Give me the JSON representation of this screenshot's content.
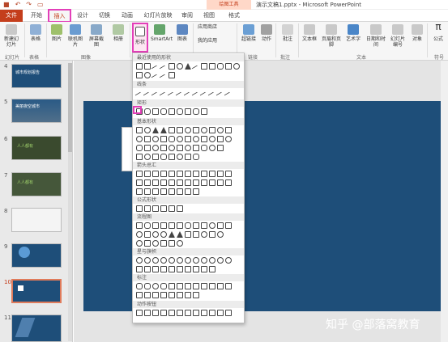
{
  "title_bar": {
    "context_tab": "绘图工具",
    "document_title": "演示文稿1.pptx - Microsoft PowerPoint",
    "qat": [
      "save-icon",
      "undo-icon",
      "redo-icon",
      "present-icon"
    ]
  },
  "tabs": [
    "文件",
    "开始",
    "插入",
    "设计",
    "切换",
    "动画",
    "幻灯片放映",
    "审阅",
    "视图",
    "格式"
  ],
  "ribbon": {
    "buttons": [
      "新建幻灯片",
      "表格",
      "图片",
      "联机图片",
      "屏幕截图",
      "相册",
      "形状",
      "SmartArt",
      "图表",
      "应用商店",
      "我的应用",
      "超链接",
      "动作",
      "批注",
      "文本框",
      "页眉和页脚",
      "艺术字",
      "日期和时间",
      "幻灯片编号",
      "对象",
      "公式"
    ],
    "groups": [
      "幻灯片",
      "表格",
      "图像",
      "插图",
      "应用程序",
      "链接",
      "批注",
      "文本",
      "符号"
    ]
  },
  "slides": [
    "4",
    "5",
    "6",
    "7",
    "8",
    "9",
    "10",
    "11"
  ],
  "slide_thumb_text": [
    "城市规划报告",
    "美丽夜空城市",
    "人人都有",
    "人人都有"
  ],
  "gallery": {
    "sections": [
      "最近使用的形状",
      "线条",
      "矩形",
      "基本形状",
      "箭头总汇",
      "公式形状",
      "流程图",
      "星与旗帜",
      "标注",
      "动作按钮"
    ]
  },
  "watermark": "知乎 @部落窝教育",
  "colors": {
    "brand": "#c43e1c",
    "highlight": "#e33fb9",
    "slide_bg": "#1e4e79"
  }
}
